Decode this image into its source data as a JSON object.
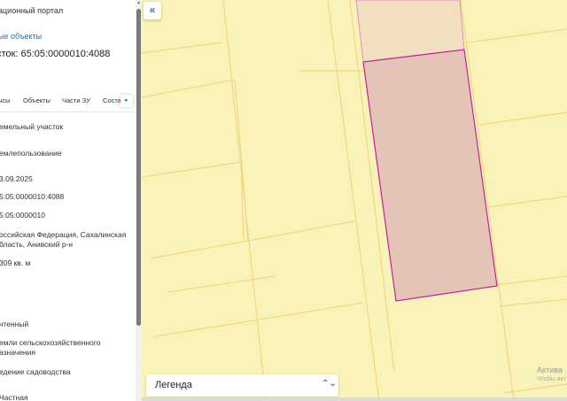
{
  "panel": {
    "portal_title": "ационный портал",
    "back_link": "ые объекты",
    "parcel_title": "сток: 65:05:0000010:4088",
    "tabs": [
      {
        "label": "ысы"
      },
      {
        "label": "Объекты"
      },
      {
        "label": "Части ЗУ"
      },
      {
        "label": "Соста"
      }
    ],
    "tab_next_arrow": "▸",
    "fields": [
      {
        "text": "емельный участок"
      },
      {
        "text": "емлепользование"
      },
      {
        "text": "3.09.2025"
      },
      {
        "text": "5:05:0000010:4088"
      },
      {
        "text": "5:05:0000010"
      },
      {
        "line1": "оссийская Федерация, Сахалинская",
        "line2": "бласть, Анивский р-н"
      },
      {
        "text": " 309 кв. м"
      },
      {
        "text": "чтенный"
      },
      {
        "line1": "емли сельскохозяйственного",
        "line2": "азначения"
      },
      {
        "text": "едение садоводства"
      },
      {
        "text": "Частная"
      }
    ],
    "scroll_up_glyph": "▲"
  },
  "map": {
    "collapse_icon_glyph": "«",
    "background_color": "#faf3b9",
    "parcel_line_color": "#f0d27a",
    "selected_fill": "#e4c4b6",
    "selected_stroke": "#c2219b",
    "neighbor_fill": "#f1dfc0",
    "neighbor_stroke": "#e58cc4",
    "legend_label": "Легенда",
    "legend_chevron": "⌃⌄",
    "activation_text": "Актива",
    "activation_subtext": "Чтобы акт"
  }
}
